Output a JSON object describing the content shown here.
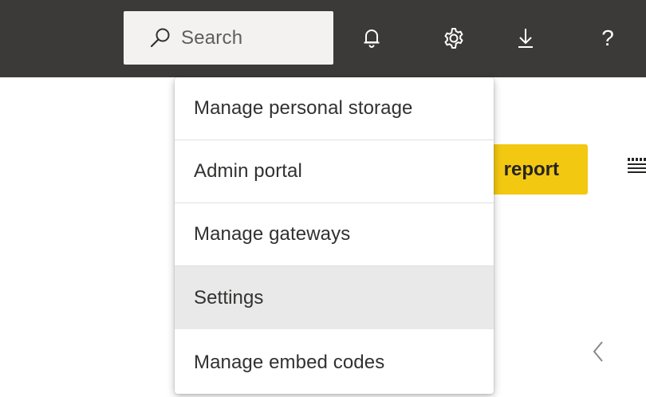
{
  "header": {
    "search": {
      "placeholder": "Search",
      "icon": "search-icon"
    },
    "icons": [
      "bell-icon",
      "gear-icon",
      "download-icon",
      "help-icon"
    ],
    "help_glyph": "?"
  },
  "settings_menu": {
    "items": [
      {
        "label": "Manage personal storage"
      },
      {
        "label": "Admin portal"
      },
      {
        "label": "Manage gateways"
      },
      {
        "label": "Settings",
        "highlighted": true
      },
      {
        "label": "Manage embed codes"
      }
    ]
  },
  "background": {
    "report_button_label_visible": "report",
    "accent_color": "#f2c811",
    "topbar_color": "#3b3a39"
  }
}
